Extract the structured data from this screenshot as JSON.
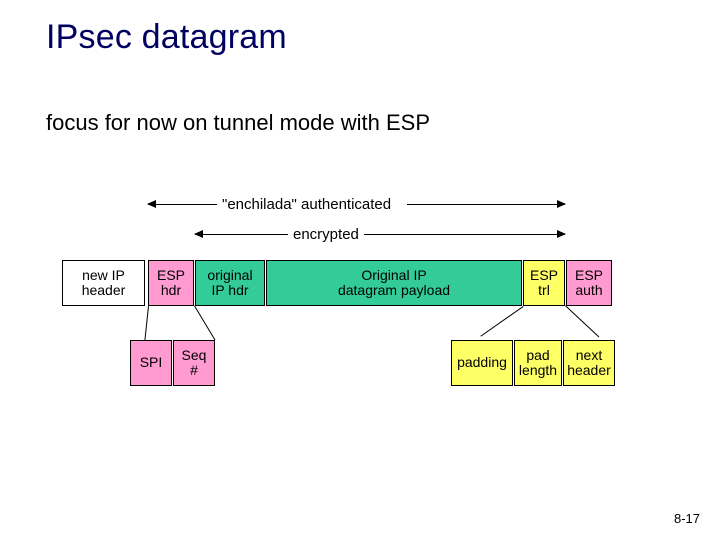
{
  "title": "IPsec datagram",
  "subtitle": "focus for now on tunnel mode with ESP",
  "labels": {
    "auth": "\"enchilada\" authenticated",
    "enc": "encrypted"
  },
  "segments": {
    "new_ip_hdr": "new IP\nheader",
    "esp_hdr": "ESP\nhdr",
    "orig_ip_hdr": "original\nIP hdr",
    "payload": "Original IP\ndatagram payload",
    "esp_trl": "ESP\ntrl",
    "esp_auth": "ESP\nauth"
  },
  "esp_hdr_fields": {
    "spi": "SPI",
    "seq": "Seq\n#"
  },
  "esp_trl_fields": {
    "padding": "padding",
    "pad_length": "pad\nlength",
    "next_hdr": "next\nheader"
  },
  "page_number": "8-17",
  "chart_data": {
    "type": "table",
    "title": "IPsec ESP tunnel-mode datagram layout",
    "rows": [
      {
        "field": "new IP header",
        "auth": false,
        "enc": false
      },
      {
        "field": "ESP hdr (SPI, Seq #)",
        "auth": true,
        "enc": false
      },
      {
        "field": "original IP hdr",
        "auth": true,
        "enc": true
      },
      {
        "field": "Original IP datagram payload",
        "auth": true,
        "enc": true
      },
      {
        "field": "ESP trl (padding, pad length, next header)",
        "auth": true,
        "enc": true
      },
      {
        "field": "ESP auth",
        "auth": false,
        "enc": false
      }
    ],
    "spans": {
      "authenticated": [
        "ESP hdr",
        "original IP hdr",
        "payload",
        "ESP trl"
      ],
      "encrypted": [
        "original IP hdr",
        "payload",
        "ESP trl"
      ]
    }
  }
}
